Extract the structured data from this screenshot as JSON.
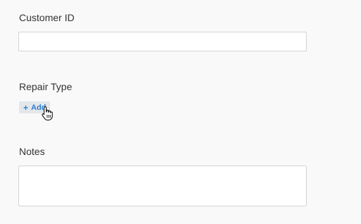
{
  "form": {
    "customer_id": {
      "label": "Customer ID",
      "value": "",
      "placeholder": ""
    },
    "repair_type": {
      "label": "Repair Type",
      "add_button": {
        "icon": "+",
        "label": "Add"
      }
    },
    "notes": {
      "label": "Notes",
      "value": "",
      "placeholder": ""
    }
  },
  "cursor": {
    "icon": "hand-pointer-icon"
  },
  "colors": {
    "background": "#f9f9f9",
    "label_text": "#333333",
    "accent": "#2d7fd3",
    "button_background": "#e3e6ea",
    "input_border": "#d4d4d4"
  }
}
